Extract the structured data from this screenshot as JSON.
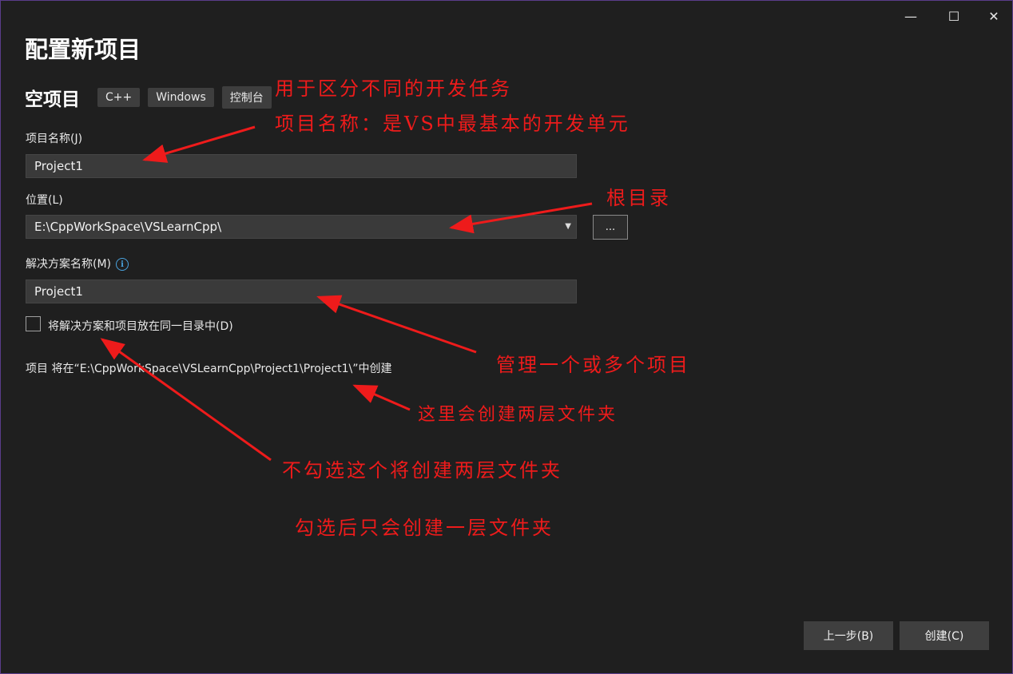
{
  "window": {
    "title": "配置新项目",
    "caption_buttons": {
      "minimize": "—",
      "maximize": "☐",
      "close": "✕"
    }
  },
  "template": {
    "name": "空项目",
    "tags": [
      "C++",
      "Windows",
      "控制台"
    ]
  },
  "fields": {
    "project_name_label": "项目名称(J)",
    "project_name_value": "Project1",
    "location_label": "位置(L)",
    "location_value": "E:\\CppWorkSpace\\VSLearnCpp\\",
    "browse_label": "...",
    "solution_name_label": "解决方案名称(M)",
    "solution_name_value": "Project1",
    "same_dir_checkbox_label": "将解决方案和项目放在同一目录中(D)",
    "same_dir_checked": false,
    "path_note": "项目 将在“E:\\CppWorkSpace\\VSLearnCpp\\Project1\\Project1\\”中创建"
  },
  "footer": {
    "back_label": "上一步(B)",
    "create_label": "创建(C)"
  },
  "annotations": {
    "tags_note": "用于区分不同的开发任务",
    "project_name_note": "项目名称：是VS中最基本的开发单元",
    "location_note": "根目录",
    "solution_note": "管理一个或多个项目",
    "path_note_comment": "这里会创建两层文件夹",
    "checkbox_note_1": "不勾选这个将创建两层文件夹",
    "checkbox_note_2": "勾选后只会创建一层文件夹",
    "color": "#ee1b1b"
  }
}
